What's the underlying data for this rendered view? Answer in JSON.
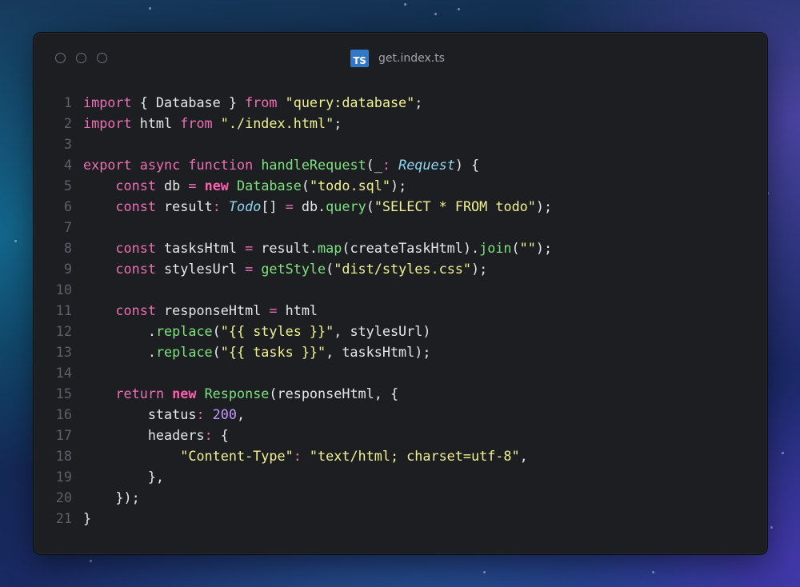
{
  "file": {
    "name": "get.index.ts",
    "language_badge": "TS"
  },
  "theme_colors": {
    "keyword": "#ec6fb3",
    "string": "#f1f08f",
    "function": "#7ee07e",
    "type": "#8fd6f0",
    "number": "#c39bff",
    "text": "#e6e6e6",
    "line_number": "#5c6068",
    "ts_badge": "#3178c6"
  },
  "code_lines": [
    {
      "n": "1",
      "tokens": [
        [
          "kw",
          "import"
        ],
        [
          "pl",
          " { Database } "
        ],
        [
          "kw",
          "from"
        ],
        [
          "pl",
          " "
        ],
        [
          "str",
          "\"query:database\""
        ],
        [
          "pl",
          ";"
        ]
      ]
    },
    {
      "n": "2",
      "tokens": [
        [
          "kw",
          "import"
        ],
        [
          "pl",
          " html "
        ],
        [
          "kw",
          "from"
        ],
        [
          "pl",
          " "
        ],
        [
          "str",
          "\"./index.html\""
        ],
        [
          "pl",
          ";"
        ]
      ]
    },
    {
      "n": "3",
      "tokens": []
    },
    {
      "n": "4",
      "tokens": [
        [
          "kw",
          "export"
        ],
        [
          "pl",
          " "
        ],
        [
          "kw",
          "async"
        ],
        [
          "pl",
          " "
        ],
        [
          "kw",
          "function"
        ],
        [
          "pl",
          " "
        ],
        [
          "fn",
          "handleRequest"
        ],
        [
          "pl",
          "(_"
        ],
        [
          "kw",
          ":"
        ],
        [
          "pl",
          " "
        ],
        [
          "ty",
          "Request"
        ],
        [
          "pl",
          ") {"
        ]
      ]
    },
    {
      "n": "5",
      "tokens": [
        [
          "pl",
          "    "
        ],
        [
          "kw",
          "const"
        ],
        [
          "pl",
          " db "
        ],
        [
          "kw",
          "="
        ],
        [
          "pl",
          " "
        ],
        [
          "kwb",
          "new"
        ],
        [
          "pl",
          " "
        ],
        [
          "fn",
          "Database"
        ],
        [
          "pl",
          "("
        ],
        [
          "str",
          "\"todo.sql\""
        ],
        [
          "pl",
          ");"
        ]
      ]
    },
    {
      "n": "6",
      "tokens": [
        [
          "pl",
          "    "
        ],
        [
          "kw",
          "const"
        ],
        [
          "pl",
          " result"
        ],
        [
          "kw",
          ":"
        ],
        [
          "pl",
          " "
        ],
        [
          "ty",
          "Todo"
        ],
        [
          "pl",
          "[] "
        ],
        [
          "kw",
          "="
        ],
        [
          "pl",
          " db."
        ],
        [
          "fn",
          "query"
        ],
        [
          "pl",
          "("
        ],
        [
          "str",
          "\"SELECT * FROM todo\""
        ],
        [
          "pl",
          ");"
        ]
      ]
    },
    {
      "n": "7",
      "tokens": []
    },
    {
      "n": "8",
      "tokens": [
        [
          "pl",
          "    "
        ],
        [
          "kw",
          "const"
        ],
        [
          "pl",
          " tasksHtml "
        ],
        [
          "kw",
          "="
        ],
        [
          "pl",
          " result."
        ],
        [
          "fn",
          "map"
        ],
        [
          "pl",
          "(createTaskHtml)."
        ],
        [
          "fn",
          "join"
        ],
        [
          "pl",
          "("
        ],
        [
          "str",
          "\"\""
        ],
        [
          "pl",
          ");"
        ]
      ]
    },
    {
      "n": "9",
      "tokens": [
        [
          "pl",
          "    "
        ],
        [
          "kw",
          "const"
        ],
        [
          "pl",
          " stylesUrl "
        ],
        [
          "kw",
          "="
        ],
        [
          "pl",
          " "
        ],
        [
          "fn",
          "getStyle"
        ],
        [
          "pl",
          "("
        ],
        [
          "str",
          "\"dist/styles.css\""
        ],
        [
          "pl",
          ");"
        ]
      ]
    },
    {
      "n": "10",
      "tokens": []
    },
    {
      "n": "11",
      "tokens": [
        [
          "pl",
          "    "
        ],
        [
          "kw",
          "const"
        ],
        [
          "pl",
          " responseHtml "
        ],
        [
          "kw",
          "="
        ],
        [
          "pl",
          " html"
        ]
      ]
    },
    {
      "n": "12",
      "tokens": [
        [
          "pl",
          "        ."
        ],
        [
          "fn",
          "replace"
        ],
        [
          "pl",
          "("
        ],
        [
          "str",
          "\"{{ styles }}\""
        ],
        [
          "pl",
          ", stylesUrl)"
        ]
      ]
    },
    {
      "n": "13",
      "tokens": [
        [
          "pl",
          "        ."
        ],
        [
          "fn",
          "replace"
        ],
        [
          "pl",
          "("
        ],
        [
          "str",
          "\"{{ tasks }}\""
        ],
        [
          "pl",
          ", tasksHtml);"
        ]
      ]
    },
    {
      "n": "14",
      "tokens": []
    },
    {
      "n": "15",
      "tokens": [
        [
          "pl",
          "    "
        ],
        [
          "kw",
          "return"
        ],
        [
          "pl",
          " "
        ],
        [
          "kwb",
          "new"
        ],
        [
          "pl",
          " "
        ],
        [
          "fn",
          "Response"
        ],
        [
          "pl",
          "(responseHtml, {"
        ]
      ]
    },
    {
      "n": "16",
      "tokens": [
        [
          "pl",
          "        status"
        ],
        [
          "kw",
          ":"
        ],
        [
          "pl",
          " "
        ],
        [
          "num",
          "200"
        ],
        [
          "pl",
          ","
        ]
      ]
    },
    {
      "n": "17",
      "tokens": [
        [
          "pl",
          "        headers"
        ],
        [
          "kw",
          ":"
        ],
        [
          "pl",
          " {"
        ]
      ]
    },
    {
      "n": "18",
      "tokens": [
        [
          "pl",
          "            "
        ],
        [
          "str",
          "\"Content-Type\""
        ],
        [
          "kw",
          ":"
        ],
        [
          "pl",
          " "
        ],
        [
          "str",
          "\"text/html; charset=utf-8\""
        ],
        [
          "pl",
          ","
        ]
      ]
    },
    {
      "n": "19",
      "tokens": [
        [
          "pl",
          "        },"
        ]
      ]
    },
    {
      "n": "20",
      "tokens": [
        [
          "pl",
          "    });"
        ]
      ]
    },
    {
      "n": "21",
      "tokens": [
        [
          "pl",
          "}"
        ]
      ]
    }
  ]
}
